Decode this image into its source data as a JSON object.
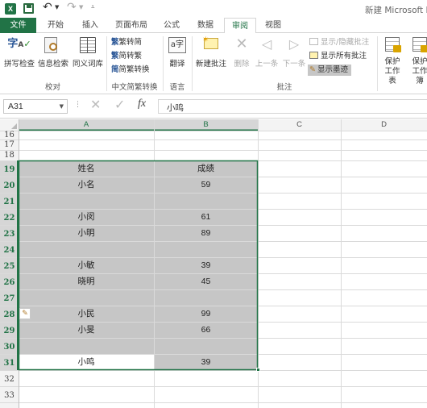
{
  "window": {
    "title": "新建 Microsoft E"
  },
  "tabs": [
    {
      "label": "文件"
    },
    {
      "label": "开始"
    },
    {
      "label": "插入"
    },
    {
      "label": "页面布局"
    },
    {
      "label": "公式"
    },
    {
      "label": "数据"
    },
    {
      "label": "审阅"
    },
    {
      "label": "视图"
    }
  ],
  "ribbon": {
    "proofing": {
      "spell": "拼写检查",
      "research": "信息检索",
      "thesaurus": "同义词库",
      "group": "校对"
    },
    "chinese": {
      "to_trad": "繁转简",
      "to_simp": "简转繁",
      "convert": "简繁转换",
      "group": "中文简繁转换"
    },
    "language": {
      "translate": "翻译",
      "group": "语言"
    },
    "comments": {
      "new": "新建批注",
      "delete": "删除",
      "prev": "上一条",
      "next": "下一条",
      "show_hide": "显示/隐藏批注",
      "show_all": "显示所有批注",
      "show_ink": "显示墨迹",
      "group": "批注"
    },
    "changes": {
      "protect_sheet": "保护工作表",
      "protect_wb": "保护工作簿"
    }
  },
  "formula_bar": {
    "name_box": "A31",
    "fx": "fx",
    "value": "小鸣"
  },
  "columns": [
    "A",
    "B",
    "C",
    "D"
  ],
  "rows": [
    {
      "num": "16",
      "a": "",
      "b": ""
    },
    {
      "num": "17",
      "a": "",
      "b": ""
    },
    {
      "num": "18",
      "a": "",
      "b": ""
    },
    {
      "num": "19",
      "a": "姓名",
      "b": "成绩"
    },
    {
      "num": "20",
      "a": "小名",
      "b": "59"
    },
    {
      "num": "21",
      "a": "",
      "b": ""
    },
    {
      "num": "22",
      "a": "小闵",
      "b": "61"
    },
    {
      "num": "23",
      "a": "小明",
      "b": "89"
    },
    {
      "num": "24",
      "a": "",
      "b": ""
    },
    {
      "num": "25",
      "a": "小敏",
      "b": "39"
    },
    {
      "num": "26",
      "a": "晓明",
      "b": "45"
    },
    {
      "num": "27",
      "a": "",
      "b": ""
    },
    {
      "num": "28",
      "a": "小民",
      "b": "99"
    },
    {
      "num": "29",
      "a": "小旻",
      "b": "66"
    },
    {
      "num": "30",
      "a": "",
      "b": ""
    },
    {
      "num": "31",
      "a": "小鸣",
      "b": "39"
    },
    {
      "num": "32",
      "a": "",
      "b": ""
    },
    {
      "num": "33",
      "a": "",
      "b": ""
    }
  ],
  "colors": {
    "accent": "#217346",
    "selection_fill": "#c6c6c6",
    "header_selected": "#d6d6d6"
  }
}
